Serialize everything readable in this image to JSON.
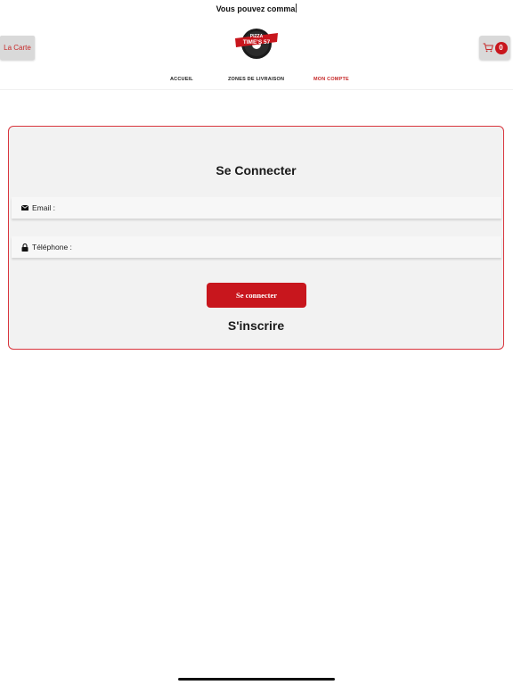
{
  "header": {
    "marquee_text": "Vous pouvez comma",
    "carte_label": "La Carte",
    "cart_count": "0"
  },
  "logo": {
    "line1": "PIZZA",
    "line2": "TIME'S 57"
  },
  "nav": {
    "items": [
      {
        "label": "ACCUEIL",
        "active": false
      },
      {
        "label": "ZONES DE LIVRAISON",
        "active": false
      },
      {
        "label": "MON COMPTE",
        "active": true
      }
    ]
  },
  "login": {
    "title": "Se Connecter",
    "email_label": "Email :",
    "phone_label": "Téléphone :",
    "submit_label": "Se connecter",
    "register_label": "S'inscrire"
  },
  "colors": {
    "brand": "#c8161d",
    "card_border": "#d9363e",
    "card_bg": "#f2f2f2"
  }
}
